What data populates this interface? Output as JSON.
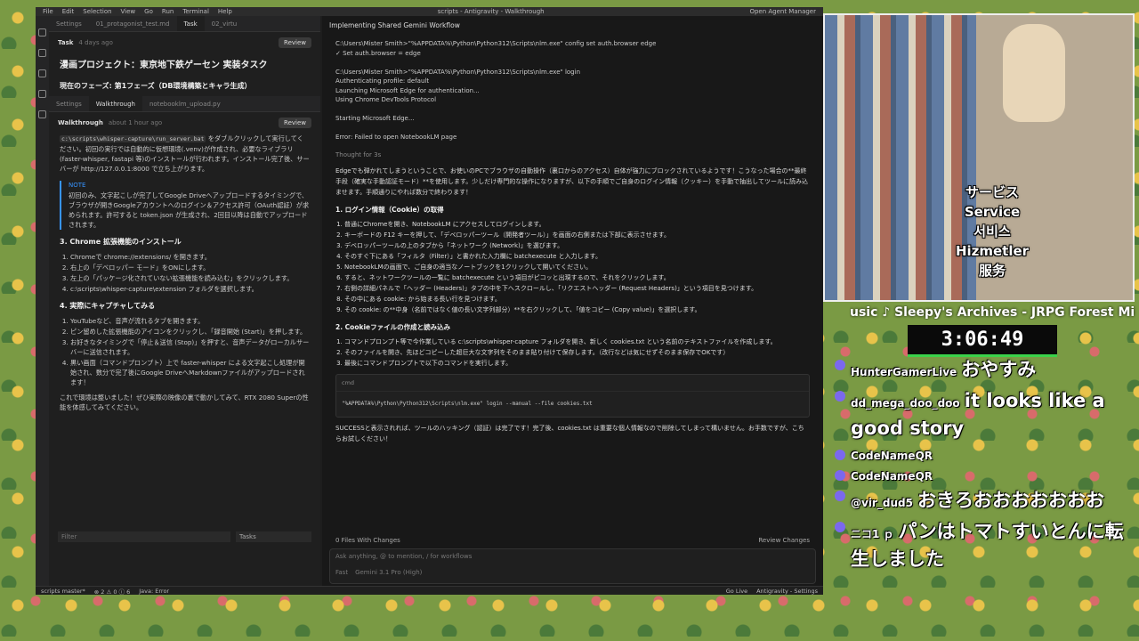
{
  "ide": {
    "title": "scripts - Antigravity - Walkthrough",
    "menu": [
      "File",
      "Edit",
      "Selection",
      "View",
      "Go",
      "Run",
      "Terminal",
      "Help"
    ],
    "agent_manager": "Open Agent Manager"
  },
  "left": {
    "tabs": [
      "Settings",
      "01_protagonist_test.md",
      "Task",
      "02_virtu"
    ],
    "task_label": "Task",
    "task_time": "4 days ago",
    "review": "Review",
    "task_heading": "漫画プロジェクト：東京地下鉄ゲーセン 実装タスク",
    "task_phase": "現在のフェーズ: 第1フェーズ（DB環境構築とキャラ生成）",
    "tabs2": [
      "Settings",
      "Walkthrough",
      "notebooklm_upload.py"
    ],
    "walk_label": "Walkthrough",
    "walk_time": "about 1 hour ago",
    "run_intro": "c:\\scripts\\whisper-capture\\run_server.bat",
    "run_text": "をダブルクリックして実行してください。初回の実行では自動的に仮想環境(.venv)が作成され、必要なライブラリ(faster-whisper, fastapi 等)のインストールが行われます。インストール完了後、サーバーが http://127.0.0.1:8000 で立ち上がります。",
    "note_label": "NOTE",
    "note_text": "初回のみ、文字起こしが完了してGoogle Driveへアップロードするタイミングで、ブラウザが開きGoogleアカウントへのログイン＆アクセス許可（OAuth認証）が求められます。許可すると token.json が生成され、2回目以降は自動でアップロードされます。",
    "sec3": "3. Chrome 拡張機能のインストール",
    "sec3_items": [
      "Chromeで chrome://extensions/ を開きます。",
      "右上の「デベロッパー モード」をONにします。",
      "左上の「パッケージ化されていない拡張機能を読み込む」をクリックします。",
      "c:\\scripts\\whisper-capture\\extension フォルダを選択します。"
    ],
    "sec4": "4. 実際にキャプチャしてみる",
    "sec4_items": [
      "YouTubeなど、音声が流れるタブを開きます。",
      "ピン留めした拡張機能のアイコンをクリックし、「録音開始 (Start)」を押します。",
      "お好きなタイミングで「停止＆送信 (Stop)」を押すと、音声データがローカルサーバーに送信されます。",
      "黒い画面（コマンドプロンプト）上で faster-whisper による文字起こし処理が開始され、数分で完了後にGoogle DriveへMarkdownファイルがアップロードされます！"
    ],
    "closing": "これで環境は整いました！ぜひ実際の映像の裏で動かしてみて、RTX 2080 Superの性能を体感してみてください。",
    "filter_placeholder": "Filter",
    "tasks_select": "Tasks"
  },
  "right": {
    "header": "Implementing Shared Gemini Workflow",
    "terminal": "C:\\Users\\Mister Smith>\"%APPDATA%\\Python\\Python312\\Scripts\\nlm.exe\" config set auth.browser edge\n✓ Set auth.browser = edge\n\nC:\\Users\\Mister Smith>\"%APPDATA%\\Python\\Python312\\Scripts\\nlm.exe\" login\nAuthenticating profile: default\nLaunching Microsoft Edge for authentication...\nUsing Chrome DevTools Protocol\n\nStarting Microsoft Edge...\n\nError: Failed to open NotebookLM page",
    "thought": "Thought for 3s",
    "intro": "Edgeでも弾かれてしまうということで、お使いのPCでブラウザの自動操作（裏口からのアクセス）自体が強力にブロックされているようです！こうなった場合の**最終手段（確実な手動認証モード）**を使用します。少しだけ専門的な操作になりますが、以下の手順でご自身のログイン情報（クッキー）を手動で抽出してツールに読み込ませます。手順通りにやれば数分で終わります！",
    "s1": "1. ログイン情報（Cookie）の取得",
    "s1_items": [
      "普通にChromeを開き、NotebookLM にアクセスしてログインします。",
      "キーボードの F12 キーを押して、「デベロッパーツール（開発者ツール）」を画面の右側または下部に表示させます。",
      "デベロッパーツールの上のタブから「ネットワーク (Network)」を選びます。",
      "そのすぐ下にある「フィルタ（Filter）」と書かれた入力欄に batchexecute と入力します。",
      "NotebookLMの画面で、ご自身の適当なノートブックを1クリックして開いてください。",
      "すると、ネットワークツールの一覧に batchexecute という項目がピコッと出現するので、それをクリックします。",
      "右側の詳細パネルで「ヘッダー (Headers)」タブの中を下へスクロールし、「リクエストヘッダー (Request Headers)」という項目を見つけます。",
      "その中にある cookie: から始まる長い行を見つけます。",
      "その cookie: の**中身（名前ではなく値の長い文字列部分）**を右クリックして、「値をコピー (Copy value)」を選択します。"
    ],
    "s2": "2. Cookieファイルの作成と読み込み",
    "s2_items": [
      "コマンドプロンプト等で今作業している c:\\scripts\\whisper-capture フォルダを開き、新しく cookies.txt という名前のテキストファイルを作成します。",
      "そのファイルを開き、先ほどコピーした超巨大な文字列をそのまま貼り付けて保存します。（改行などは気にせずそのまま保存でOKです）",
      "最後にコマンドプロンプトで以下のコマンドを実行します。"
    ],
    "cmd_label": "cmd",
    "cmd": "\"%APPDATA%\\Python\\Python312\\Scripts\\nlm.exe\" login --manual --file cookies.txt",
    "success": "SUCCESSと表示されれば、ツールのハッキング（認証）は完了です！完了後、cookies.txt は重要な個人情報なので削除してしまって構いません。お手数ですが、こちらお試しください！",
    "files_changes": "0 Files With Changes",
    "review_changes": "Review Changes",
    "ask_placeholder": "Ask anything, @ to mention, / for workflows",
    "mode": "Fast",
    "model": "Gemini 3.1 Pro (High)"
  },
  "status": {
    "branch": "scripts  master*",
    "errors": "⊗ 2 ⚠ 0 ⓘ 6",
    "java": "Java: Error",
    "golive": "Go Live",
    "settings": "Antigravity - Settings"
  },
  "stream": {
    "caption": [
      "サービス",
      "Service",
      "서비스",
      "Hizmetler",
      "服务"
    ],
    "music": "usic ♪ Sleepy's Archives - JRPG Forest Mi",
    "timer": "3:06:49",
    "chat": [
      {
        "user": "HunterGamerLive",
        "text": "おやすみ"
      },
      {
        "user": "dd_mega_doo_doo",
        "text": "it looks like a good story"
      },
      {
        "user": "CodeNameQR",
        "text": ""
      },
      {
        "user": "CodeNameQR",
        "text": ""
      },
      {
        "user": "@vir_dud5",
        "text": "おきろおおおおおおお"
      },
      {
        "user": "ニコ1 ｐ",
        "text": "パンはトマトすいとんに転生しました"
      }
    ]
  }
}
